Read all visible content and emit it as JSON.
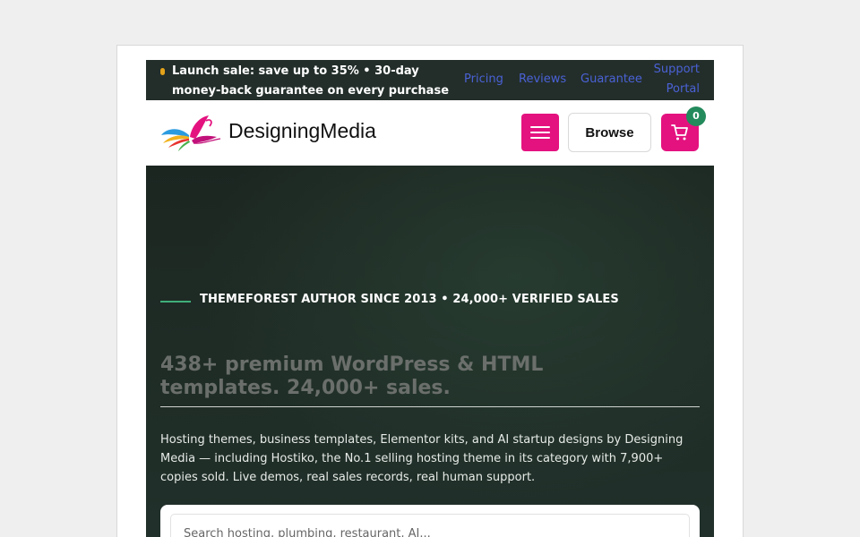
{
  "announcement": {
    "text": "Launch sale: save up to 35% • 30-day money-back guarantee on every purchase"
  },
  "top_links": {
    "pricing": "Pricing",
    "reviews": "Reviews",
    "guarantee": "Guarantee",
    "support": "Support Portal"
  },
  "header": {
    "brand": "DesigningMedia",
    "browse_label": "Browse",
    "cart_count": "0"
  },
  "hero": {
    "kicker": "THEMEFOREST AUTHOR SINCE 2013 • 24,000+ VERIFIED SALES",
    "title": "438+ premium WordPress & HTML templates. 24,000+ sales.",
    "description": "Hosting themes, business templates, Elementor kits, and AI startup designs by Designing Media — including Hostiko, the No.1 selling hosting theme in its category with 7,900+ copies sold. Live demos, real sales records, real human support."
  },
  "search": {
    "placeholder": "Search hosting, plumbing, restaurant, AI..."
  },
  "colors": {
    "accent": "#e4127f",
    "badge": "#238a5c",
    "link": "#4a61d6",
    "announce_bg": "#232e2a",
    "hero_bg": "#1f2c26"
  },
  "icons": {
    "menu": "hamburger-icon",
    "cart": "shopping-cart-icon",
    "logo": "butterfly-logo"
  }
}
